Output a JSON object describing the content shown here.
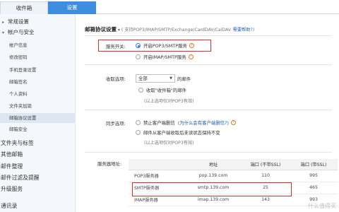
{
  "tabs": {
    "inbox": "收件箱",
    "settings": "设置"
  },
  "sidebar": {
    "general": "常规设置",
    "account_security": "帐户与安全",
    "account_items": [
      "帐户信息",
      "修改密码",
      "手机登录设置",
      "邮箱签名",
      "个人资料",
      "文件夹加锁",
      "邮箱协议设置",
      "邮箱安全"
    ],
    "roots": [
      "文件夹与标签",
      "其他邮箱",
      "邮件整理",
      "邮件过滤及提醒",
      "升级服务",
      "通讯录"
    ]
  },
  "main": {
    "title": "邮箱协议设置",
    "subtitle": "( 支持POP3/IMAP/SMTP/Exchange/CardDAV/CalDAV",
    "help": "需要帮助?",
    "subtitle_end": ")",
    "service_switch": {
      "label": "服务开关:",
      "options": [
        "开启POP3/SMTP服务",
        "开启IMAP/SMTP服务"
      ],
      "selected": "开启POP3/SMTP服务"
    },
    "collect": {
      "label": "收取选项:",
      "select_value": "全部",
      "suffix": "的邮件",
      "checkbox": "收取\"收件箱\"的邮件",
      "note": "(以上选项仅对POP3有效)"
    },
    "sync": {
      "label": "同步选项:",
      "opt1": "禁止客户端删信",
      "opt1_link": "(为什么会有客户端删信?)",
      "opt2": "邮件从客户端收取后未读状态保持不变",
      "note": "(以上选项仅对POP3有效)"
    },
    "servers": {
      "label": "服务器地址:",
      "headers": [
        "",
        "地址",
        "端口 (不带SSL)",
        "端口 (带SSL)"
      ],
      "rows": [
        [
          "POP3服务器",
          "pop.139.com",
          "110",
          "995"
        ],
        [
          "SMTP服务器",
          "smtp.139.com",
          "25",
          "465"
        ],
        [
          "IMAP服务器",
          "imap.139.com",
          "143",
          "993"
        ]
      ]
    }
  },
  "watermark": "什么值得买"
}
